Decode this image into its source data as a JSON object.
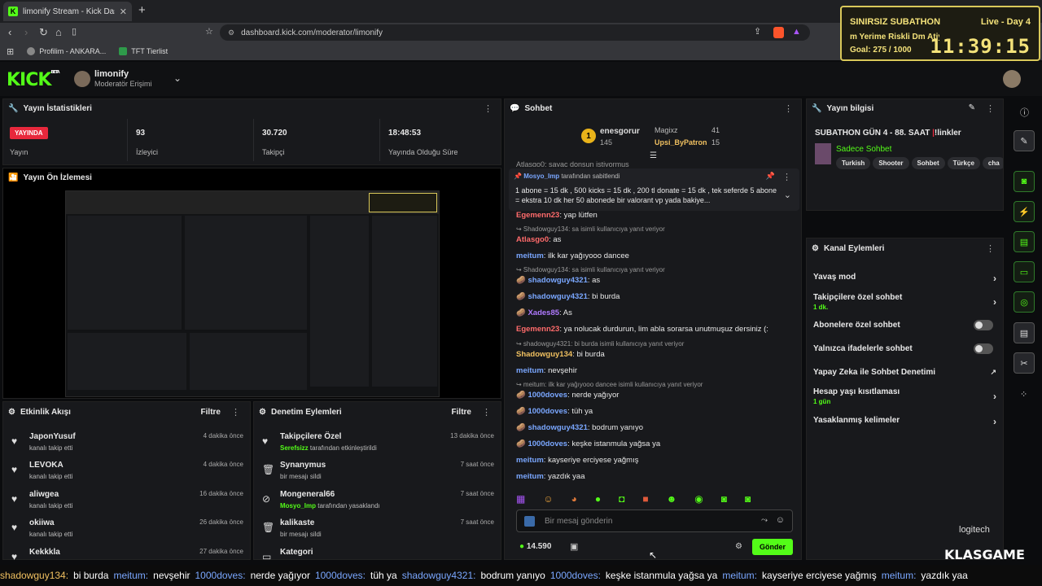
{
  "browser": {
    "tab_title": "limonify Stream - Kick Dashb",
    "url": "dashboard.kick.com/moderator/limonify",
    "bookmarks": [
      "Profilim - ANKARA...",
      "TFT Tierlist"
    ]
  },
  "overlay": {
    "title": "SINIRSIZ SUBATHON",
    "status": "Live - Day 4",
    "scroll": "m Yerime Riskli Dm Atiy",
    "goal": "Goal: 275 / 1000",
    "timer": "11:39:15"
  },
  "header": {
    "logo": "KICK",
    "logo_beta": "BETA",
    "channel": "limonify",
    "role": "Moderatör Erişimi"
  },
  "stats": {
    "title": "Yayın İstatistikleri",
    "live_badge": "YAYINDA",
    "live_label": "Yayın",
    "viewers": "93",
    "viewers_label": "İzleyici",
    "followers": "30.720",
    "followers_label": "Takipçi",
    "uptime": "18:48:53",
    "uptime_label": "Yayında Olduğu Süre"
  },
  "preview": {
    "title": "Yayın Ön İzlemesi"
  },
  "activity": {
    "title": "Etkinlik Akışı",
    "filter": "Filtre",
    "items": [
      {
        "name": "JaponYusuf",
        "sub": "kanalı takip etti",
        "time": "4 dakika önce"
      },
      {
        "name": "LEVOKA",
        "sub": "kanalı takip etti",
        "time": "4 dakika önce"
      },
      {
        "name": "aliwgea",
        "sub": "kanalı takip etti",
        "time": "16 dakika önce"
      },
      {
        "name": "okiiwa",
        "sub": "kanalı takip etti",
        "time": "26 dakika önce"
      },
      {
        "name": "Kekkkla",
        "sub": "",
        "time": "27 dakika önce"
      }
    ]
  },
  "modactions": {
    "title": "Denetim Eylemleri",
    "filter": "Filtre",
    "items": [
      {
        "name": "Takipçilere Özel",
        "who": "Serefsizz",
        "sub": " tarafından etkinleştirildi",
        "time": "13 dakika önce"
      },
      {
        "name": "Synanymus",
        "who": "",
        "sub": "bir mesajı sildi",
        "time": "7 saat önce"
      },
      {
        "name": "Mongeneral66",
        "who": "Mosyo_Imp",
        "sub": " tarafından yasaklandı",
        "time": "7 saat önce"
      },
      {
        "name": "kalikaste",
        "who": "",
        "sub": "bir mesajı sildi",
        "time": "7 saat önce"
      },
      {
        "name": "Kategori",
        "who": "",
        "sub": "",
        "time": "7 saat önce"
      }
    ]
  },
  "chat": {
    "title": "Sohbet",
    "top_gifter": "enesgorur",
    "top_count": "145",
    "gifter2": "Magixz",
    "gifter2_count": "41",
    "gifter3": "Upsi_ByPatron",
    "gifter3_count": "15",
    "scroll_line": "Atlasgo0: sayac donsun istiyormus",
    "pin_by": "Mosyo_Imp",
    "pin_suffix": "tarafından sabitlendi",
    "pin_text": "1 abone = 15 dk , 500 kicks = 15 dk , 200 tl donate = 15 dk , tek seferde 5 abone = ekstra 10 dk her 50 abonede bir valorant vp yada bakiye...",
    "messages": [
      {
        "n": "Egemenn23",
        "t": ": yap lütfen",
        "c": "#ff6b6b"
      },
      {
        "r": "Shadowguy134: sa isimli kullanıcıya yanıt veriyor"
      },
      {
        "n": "Atlasgo0",
        "t": ": as",
        "c": "#ff6b6b"
      },
      {
        "n": "meitum",
        "t": ": ilk kar yağıyooo dancee",
        "c": "#7aa7ff"
      },
      {
        "r": "Shadowguy134: sa isimli kullanıcıya yanıt veriyor"
      },
      {
        "n": "shadowguy4321",
        "t": ": as",
        "c": "#7aa7ff",
        "b": 1
      },
      {
        "n": "shadowguy4321",
        "t": ": bi burda",
        "c": "#7aa7ff",
        "b": 1
      },
      {
        "n": "Xades85",
        "t": ": As",
        "c": "#b07aff",
        "b": 1
      },
      {
        "n": "Egemenn23",
        "t": ": ya nolucak durdurun, lim abla sorarsa unutmuşuz dersiniz (:",
        "c": "#ff6b6b"
      },
      {
        "r": "shadowguy4321: bi burda isimli kullanıcıya yanıt veriyor"
      },
      {
        "n": "Shadowguy134",
        "t": ": bi burda",
        "c": "#f0c060"
      },
      {
        "n": "meitum",
        "t": ": nevşehir",
        "c": "#7aa7ff"
      },
      {
        "r": "meitum: ilk kar yağıyooo dancee isimli kullanıcıya yanıt veriyor"
      },
      {
        "n": "1000doves",
        "t": ": nerde yağıyor",
        "c": "#7aa7ff",
        "b": 1
      },
      {
        "n": "1000doves",
        "t": ": tüh ya",
        "c": "#7aa7ff",
        "b": 1
      },
      {
        "n": "shadowguy4321",
        "t": ": bodrum yanıyo",
        "c": "#7aa7ff",
        "b": 1
      },
      {
        "n": "1000doves",
        "t": ": keşke istanmula yağsa ya",
        "c": "#7aa7ff",
        "b": 1
      },
      {
        "n": "meitum",
        "t": ": kayseriye erciyese yağmış",
        "c": "#7aa7ff"
      },
      {
        "n": "meitum",
        "t": ": yazdık yaa",
        "c": "#7aa7ff"
      }
    ],
    "input_placeholder": "Bir mesaj gönderin",
    "kicks": "14.590",
    "send": "Gönder"
  },
  "info": {
    "title": "Yayın bilgisi",
    "stream_title": "SUBATHON GÜN 4 - 88. SAAT",
    "links": "!linkler",
    "category": "Sadece Sohbet",
    "tags": [
      "Turkish",
      "Shooter",
      "Sohbet",
      "Türkçe",
      "cha"
    ]
  },
  "channel_actions": {
    "title": "Kanal Eylemleri",
    "items": [
      {
        "label": "Yavaş mod",
        "sub": "",
        "kind": "arrow"
      },
      {
        "label": "Takipçilere özel sohbet",
        "sub": "1 dk.",
        "kind": "arrow"
      },
      {
        "label": "Abonelere özel sohbet",
        "sub": "",
        "kind": "toggle"
      },
      {
        "label": "Yalnızca ifadelerle sohbet",
        "sub": "",
        "kind": "toggle"
      },
      {
        "label": "Yapay Zeka ile Sohbet Denetimi",
        "sub": "",
        "kind": "ext"
      },
      {
        "label": "Hesap yaşı kısıtlaması",
        "sub": "1 gün",
        "kind": "arrow"
      },
      {
        "label": "Yasaklanmış kelimeler",
        "sub": "",
        "kind": "arrow"
      }
    ]
  },
  "ticker": [
    {
      "n": "shadowguy134:",
      "t": "bi burda",
      "c": "#f0c060"
    },
    {
      "n": "meitum:",
      "t": "nevşehir",
      "c": "#7aa7ff"
    },
    {
      "n": "1000doves:",
      "t": "nerde yağıyor",
      "c": "#7aa7ff"
    },
    {
      "n": "1000doves:",
      "t": "tüh ya",
      "c": "#7aa7ff"
    },
    {
      "n": "shadowguy4321:",
      "t": "bodrum yanıyo",
      "c": "#7aa7ff"
    },
    {
      "n": "1000doves:",
      "t": "keşke istanmula yağsa ya",
      "c": "#7aa7ff"
    },
    {
      "n": "meitum:",
      "t": "kayseriye erciyese yağmış",
      "c": "#7aa7ff"
    },
    {
      "n": "meitum:",
      "t": "yazdık yaa",
      "c": "#7aa7ff"
    }
  ],
  "brand": {
    "logitech": "logitech",
    "klasgame": "KLASGAME",
    "accent": "#53fc18"
  }
}
